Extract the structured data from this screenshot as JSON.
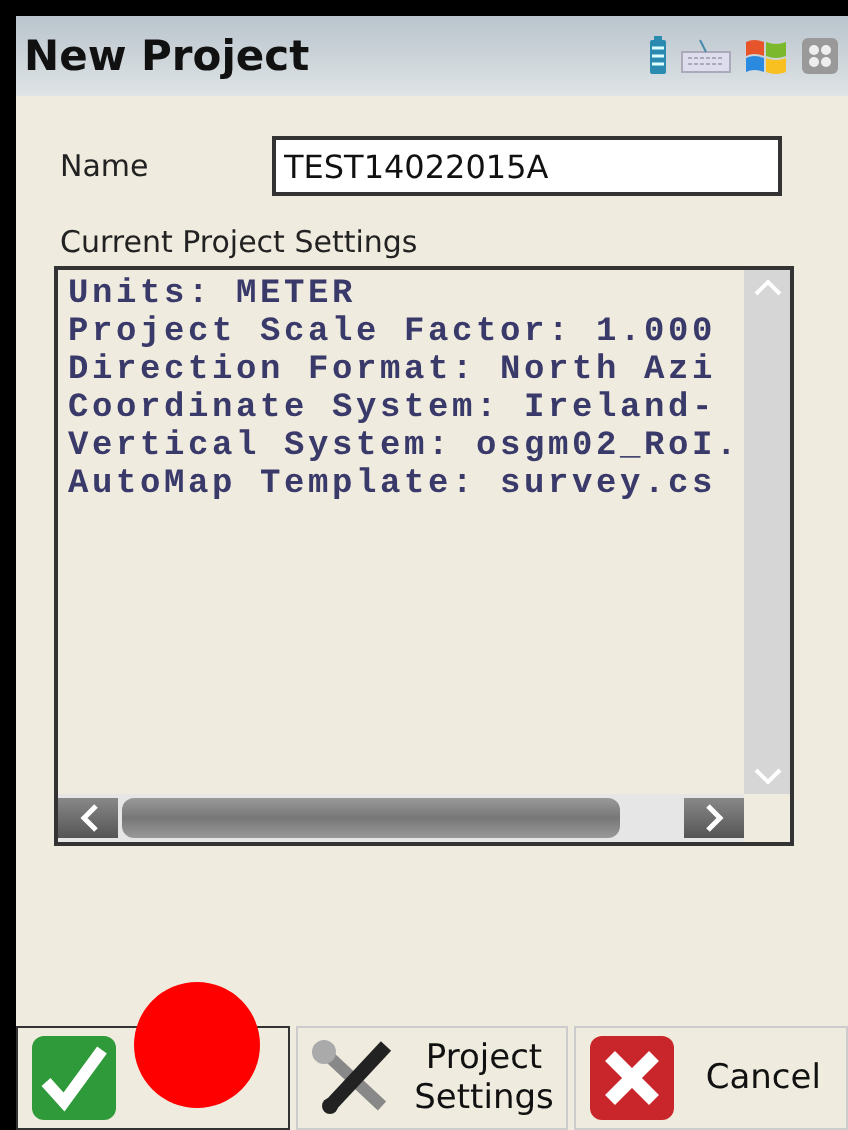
{
  "window": {
    "title": "New Project"
  },
  "name_field": {
    "label": "Name",
    "value": "TEST14022015A"
  },
  "settings": {
    "label": "Current Project Settings",
    "lines": [
      "Units: METER",
      "Project Scale Factor: 1.000",
      "Direction Format: North Azi",
      "Coordinate System: Ireland-",
      "Vertical System: osgm02_RoI.",
      "AutoMap Template: survey.cs"
    ]
  },
  "buttons": [
    {
      "kind": "ok"
    },
    {
      "kind": "settings",
      "label": "Project Settings"
    },
    {
      "kind": "cancel",
      "label": "Cancel"
    }
  ],
  "touch_marker": true
}
